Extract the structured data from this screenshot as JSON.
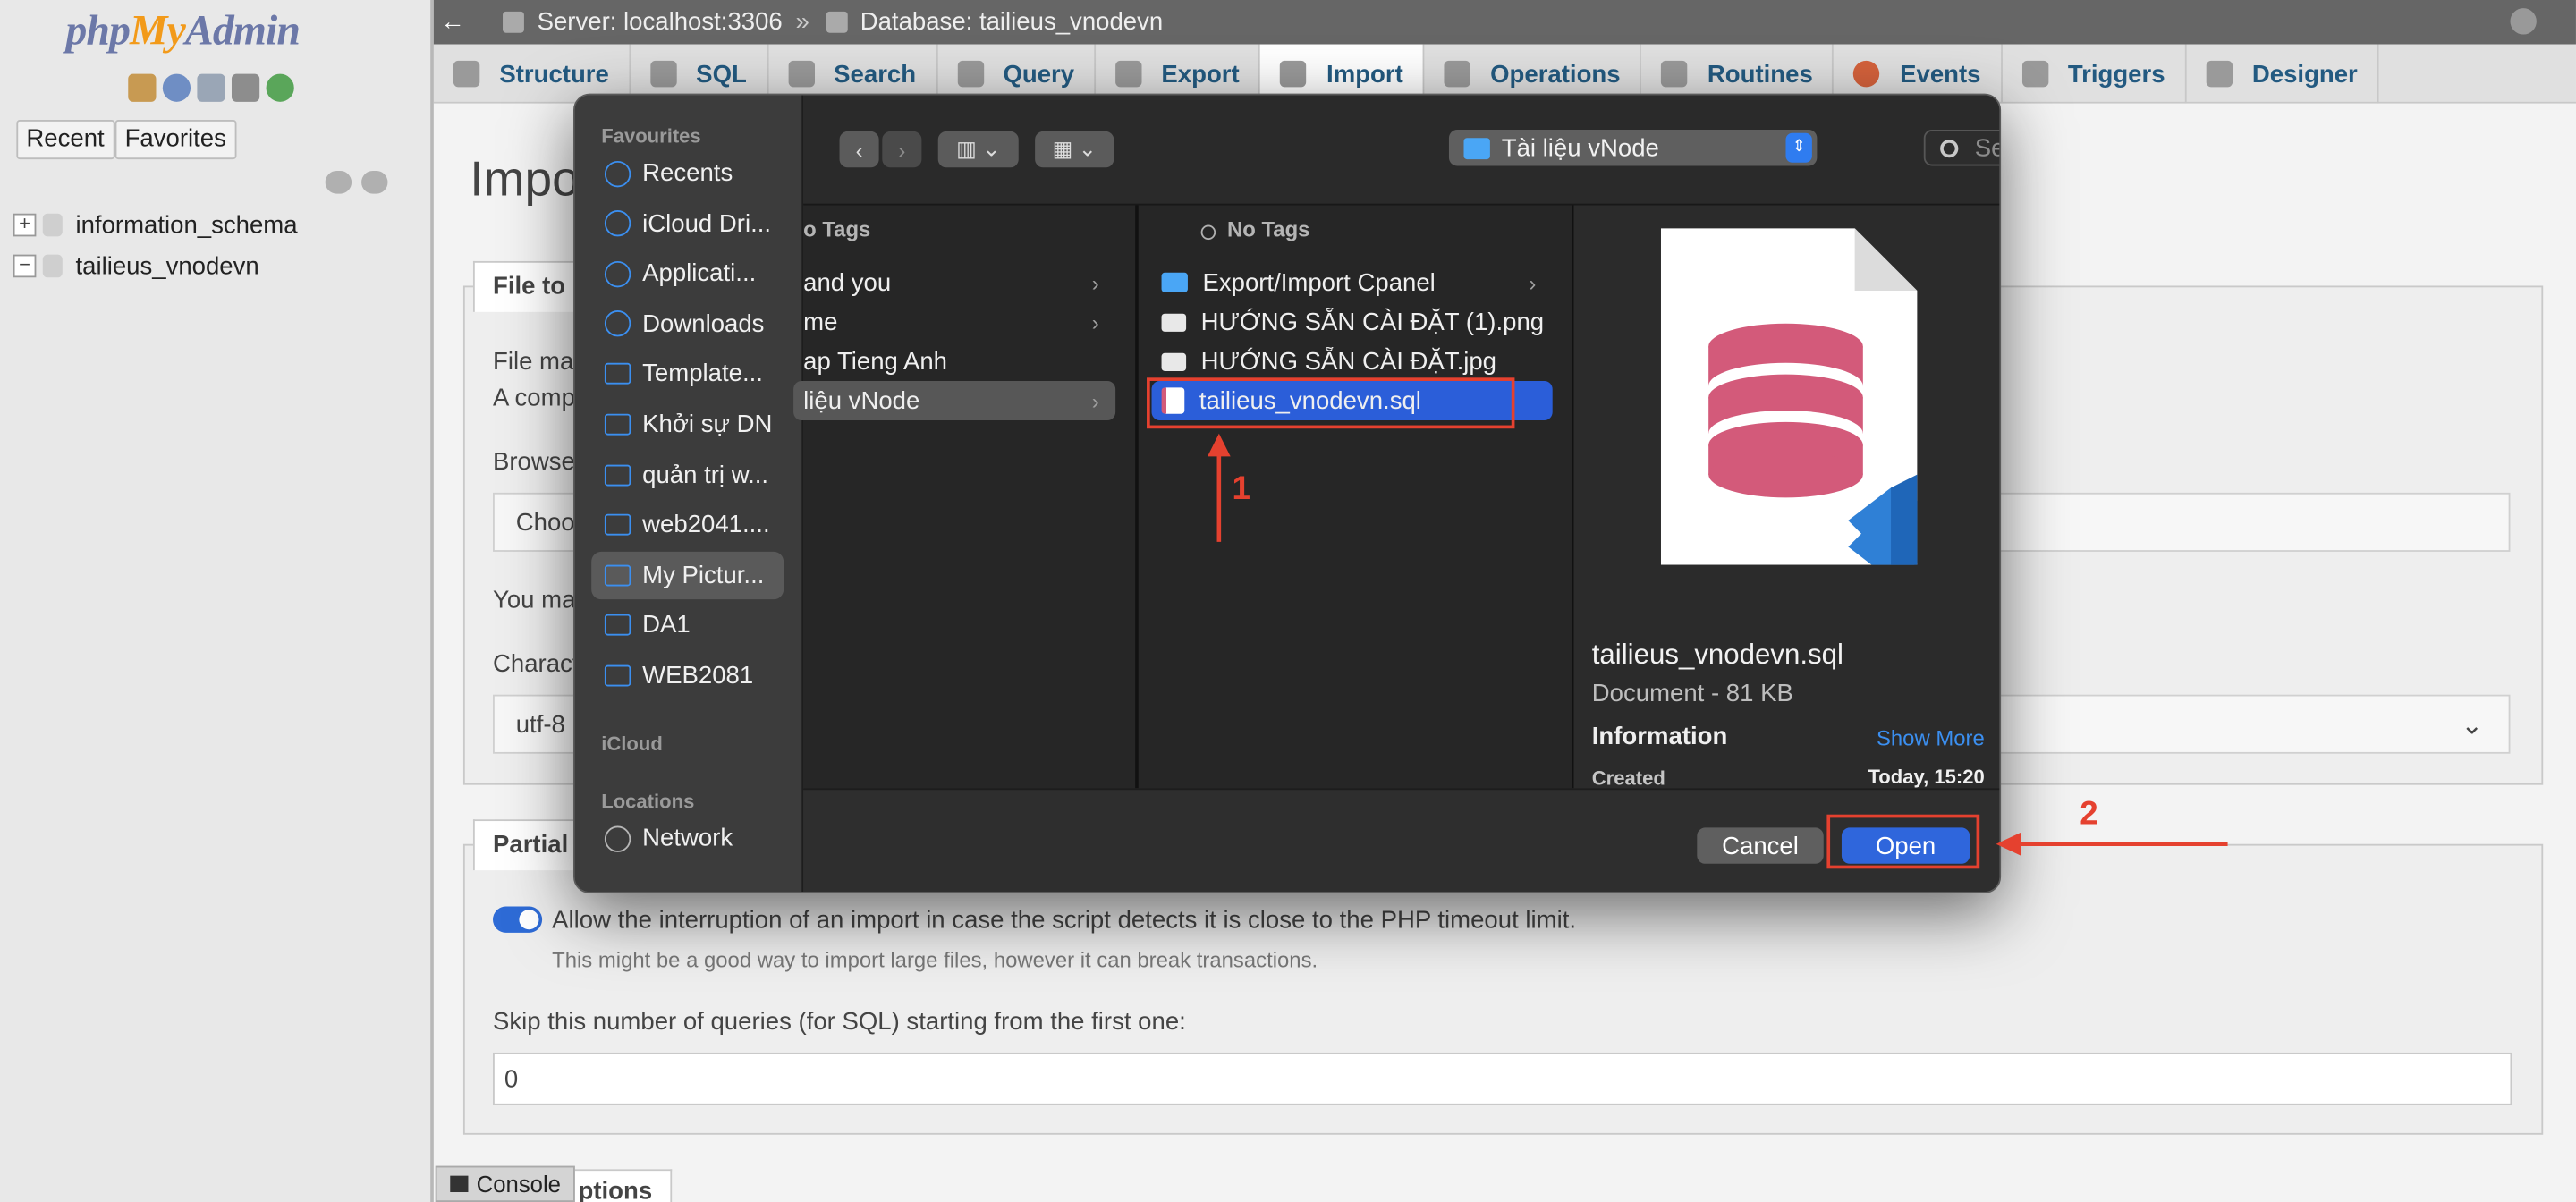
{
  "pma": {
    "logo": {
      "php": "php",
      "my": "My",
      "admin": "Admin"
    },
    "sidebar": {
      "buttons": [
        "Recent",
        "Favorites"
      ],
      "databases": [
        "information_schema",
        "tailieus_vnodevn"
      ]
    },
    "breadcrumb": {
      "server": "Server: localhost:3306",
      "separator": "»",
      "database": "Database: tailieus_vnodevn"
    },
    "tabs": [
      "Structure",
      "SQL",
      "Search",
      "Query",
      "Export",
      "Import",
      "Operations",
      "Routines",
      "Events",
      "Triggers",
      "Designer"
    ],
    "page_heading": "Impo",
    "file_section": {
      "legend": "File to i",
      "line1": "File ma",
      "line2": "A comp",
      "browse": "Browse",
      "choose": "Choo",
      "you_may": "You ma",
      "charset_label": "Charact",
      "charset_value": "utf-8"
    },
    "partial_section": {
      "legend": "Partial",
      "allow_text": "Allow the interruption of an import in case the script detects it is close to the PHP timeout limit.",
      "allow_hint": "This might be a good way to import large files, however it can break transactions.",
      "allow_on": true,
      "skip_label": "Skip this number of queries (for SQL) starting from the first one:",
      "skip_value": "0"
    },
    "other_legend": "ptions",
    "console": "Console"
  },
  "dialog": {
    "sidebar": {
      "favourites_label": "Favourites",
      "favourites": [
        "Recents",
        "iCloud Dri...",
        "Applicati...",
        "Downloads",
        "Template...",
        "Khởi sự DN",
        "quản trị w...",
        "web2041....",
        "My Pictur...",
        "DA1",
        "WEB2081"
      ],
      "favourite_icons": [
        "clock-icon",
        "cloud-icon",
        "apps-icon",
        "download-icon",
        "folder-icon",
        "folder-icon",
        "folder-icon",
        "folder-icon",
        "folder-icon",
        "folder-icon",
        "folder-icon"
      ],
      "active_index": 8,
      "icloud_label": "iCloud",
      "locations_label": "Locations",
      "locations": [
        "Network"
      ]
    },
    "toolbar": {
      "back": "‹",
      "forward": "›",
      "view_columns": "▥ ⌄",
      "view_grid": "▦ ⌄",
      "location": "Tài liệu vNode",
      "search_placeholder": "Search"
    },
    "col1": {
      "header": "o Tags",
      "items": [
        "and you",
        "me",
        "ap Tieng Anh",
        "liệu vNode"
      ],
      "has_arrow": [
        true,
        true,
        false,
        true
      ],
      "selected_index": 3
    },
    "col2": {
      "header": "No Tags",
      "items": [
        "Export/Import Cpanel",
        "HƯỚNG SẴN CÀI ĐẶT (1).png",
        "HƯỚNG SẴN CÀI ĐẶT.jpg",
        "tailieus_vnodevn.sql"
      ],
      "kinds": [
        "folder",
        "image",
        "image",
        "sql"
      ],
      "selected_index": 3
    },
    "preview": {
      "filename": "tailieus_vnodevn.sql",
      "kind_size": "Document - 81 KB",
      "info_label": "Information",
      "show_more": "Show More",
      "created_label": "Created",
      "created_value": "Today, 15:20"
    },
    "buttons": {
      "cancel": "Cancel",
      "open": "Open"
    }
  },
  "annotations": {
    "step1": "1",
    "step2": "2",
    "color": "#e5412f"
  },
  "colors": {
    "accent_blue": "#2b5ed9",
    "pma_link": "#235a81",
    "sql_pink": "#d35a7a"
  }
}
